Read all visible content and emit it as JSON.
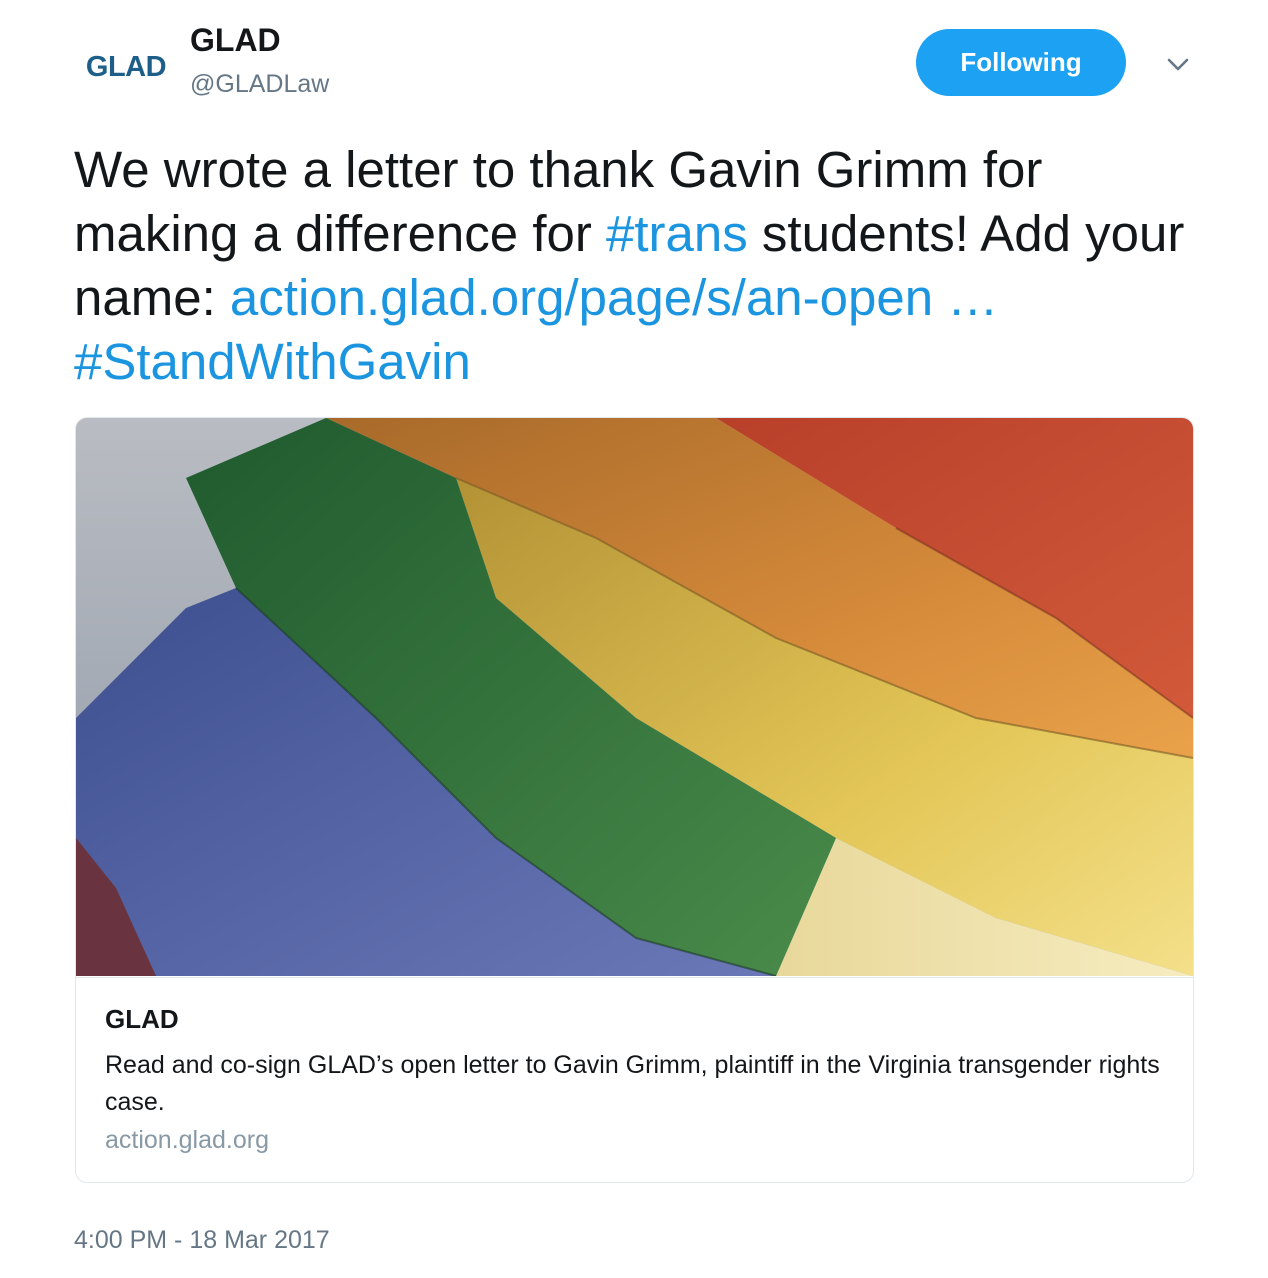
{
  "header": {
    "logo_text": "GLAD",
    "display_name": "GLAD",
    "handle": "@GLADLaw",
    "follow_button_label": "Following",
    "menu_icon": "chevron-down-icon"
  },
  "tweet": {
    "text_part1": "We wrote a letter to thank Gavin Grimm for making a difference for ",
    "hashtag1": "#trans",
    "text_part2": " students! Add your name: ",
    "link": "action.glad.org/page/s/an-open …",
    "text_part3": " ",
    "hashtag2": "#StandWithGavin"
  },
  "card": {
    "image_alt": "Rainbow pride flag",
    "title": "GLAD",
    "description": "Read and co-sign GLAD’s open letter to Gavin Grimm, plaintiff in the Virginia transgender rights case.",
    "domain": "action.glad.org"
  },
  "timestamp": "4:00 PM - 18 Mar 2017",
  "colors": {
    "accent": "#1da1f2",
    "link": "#1b95e0",
    "muted": "#657786"
  }
}
